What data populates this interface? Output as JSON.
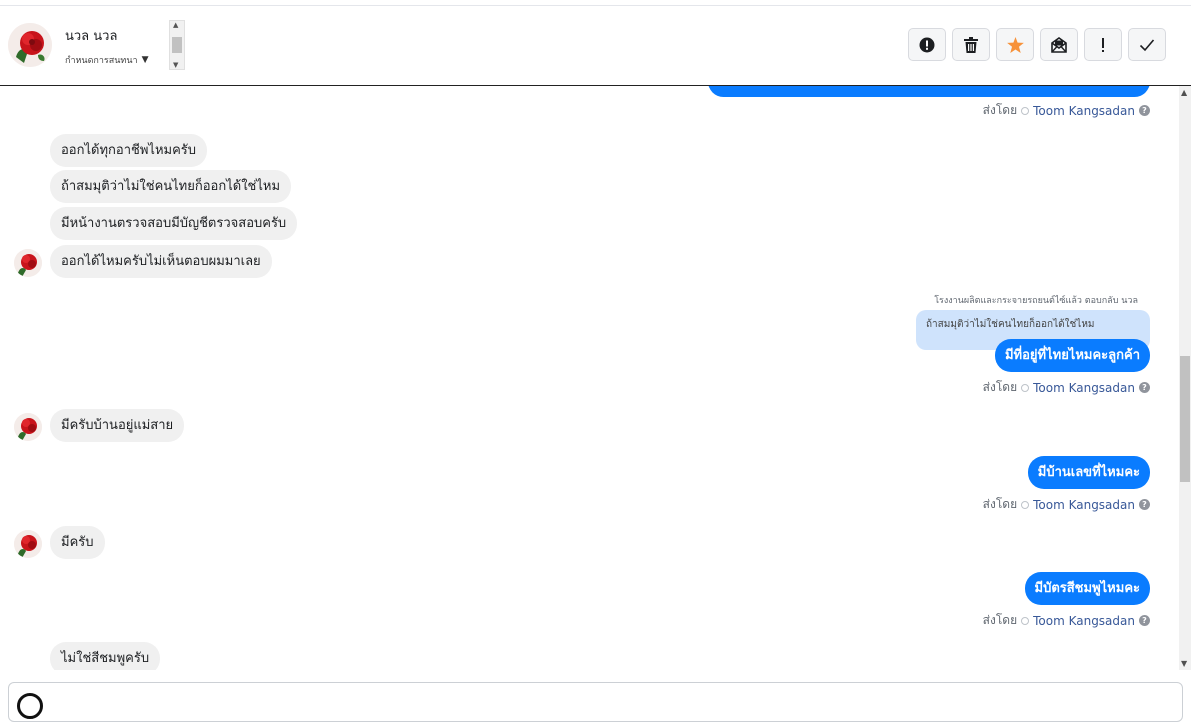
{
  "header": {
    "contact_name": "นวล นวล",
    "assign_label": "กำหนดการสนทนา",
    "actions": [
      {
        "name": "report-spam-button",
        "icon": "alert-circle-icon"
      },
      {
        "name": "delete-button",
        "icon": "trash-icon"
      },
      {
        "name": "star-button",
        "icon": "star-icon"
      },
      {
        "name": "mark-unread-button",
        "icon": "envelope-icon"
      },
      {
        "name": "priority-button",
        "icon": "exclamation-icon"
      },
      {
        "name": "mark-done-button",
        "icon": "check-icon"
      }
    ]
  },
  "colors": {
    "outgoing_bubble": "#0a7cff",
    "incoming_bubble": "#f0f0f0",
    "star": "#f7923a",
    "quoted_bg": "#cfe3fc"
  },
  "messages": {
    "sent_by_label": "ส่งโดย",
    "agent_name": "Toom Kangsadan",
    "in_1": "ออกได้ทุกอาชีพไหมครับ",
    "in_2": "ถ้าสมมุติว่าไม่ใช่คนไทยก็ออกได้ใช่ไหม",
    "in_3": "มีหน้างานตรวจสอบมีบัญชีตรวจสอบครับ",
    "in_4": "ออกได้ไหมครับไม่เห็นตอบผมมาเลย",
    "reply_meta": "โรงงานผลิตและกระจายรถยนต์ไซ์แล้ว ตอบกลับ นวล",
    "quoted_text": "ถ้าสมมุติว่าไม่ใช่คนไทยก็ออกได้ใช่ไหม",
    "out_1": "มีที่อยู่ที่ไทยไหมคะลูกค้า",
    "in_5": "มีครับบ้านอยู่แม่สาย",
    "out_2": "มีบ้านเลขที่ไหมคะ",
    "in_6": "มีครับ",
    "out_3": "มีบัตรสีชมพูไหมคะ",
    "in_7": "ไม่ใช่สีชมพูครับ"
  }
}
